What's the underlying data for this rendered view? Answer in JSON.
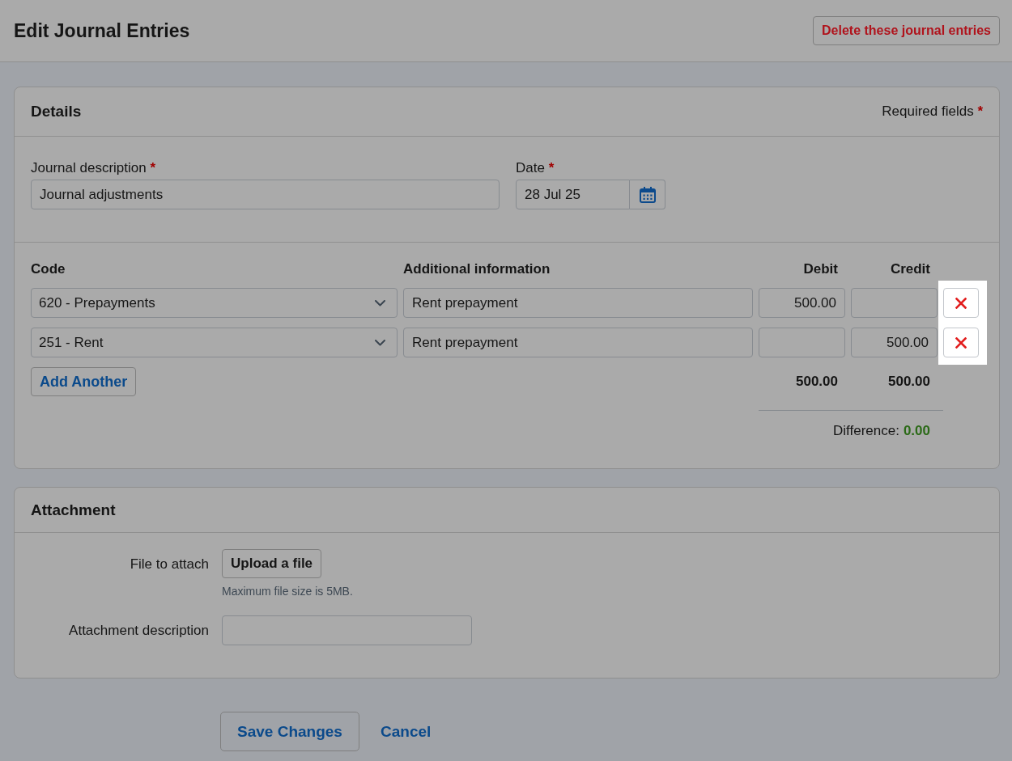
{
  "overlay": {
    "dimmed": true,
    "remove_buttons_highlighted": true
  },
  "header": {
    "title": "Edit Journal Entries",
    "delete_button": "Delete these journal entries"
  },
  "details": {
    "title": "Details",
    "required_note": {
      "text": "Required fields",
      "mark": "*"
    },
    "description": {
      "label": "Journal description",
      "required_mark": "*",
      "value": "Journal adjustments"
    },
    "date": {
      "label": "Date",
      "required_mark": "*",
      "value": "28 Jul 25"
    },
    "columns": [
      {
        "label": "Code",
        "numeric": false
      },
      {
        "label": "Additional information",
        "numeric": false
      },
      {
        "label": "Debit",
        "numeric": true
      },
      {
        "label": "Credit",
        "numeric": true
      }
    ],
    "lines": [
      {
        "code": "620 - Prepayments",
        "info": "Rent prepayment",
        "debit": "500.00"
      },
      {
        "code": "251 - Rent",
        "info": "Rent prepayment",
        "credit": "500.00"
      }
    ],
    "add_button": "Add Another",
    "totals": {
      "debit": "500.00",
      "credit": "500.00"
    },
    "difference": {
      "label": "Difference:",
      "value": "0.00",
      "balanced": true
    }
  },
  "attachment": {
    "title": "Attachment",
    "file": {
      "label": "File to attach",
      "button": "Upload a file",
      "hint": "Maximum file size is 5MB."
    },
    "description": {
      "label": "Attachment description"
    }
  },
  "actions": {
    "save": "Save Changes",
    "cancel": "Cancel"
  }
}
